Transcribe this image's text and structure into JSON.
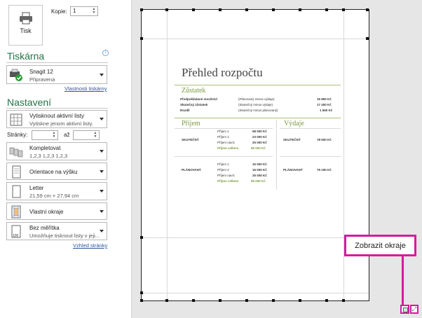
{
  "print_button": {
    "label": "Tisk"
  },
  "copies": {
    "label": "Kopie:",
    "value": "1"
  },
  "printer": {
    "section_title": "Tiskárna",
    "info_icon": "info-icon",
    "name": "Snagit 12",
    "status": "Připravena",
    "properties_link": "Vlastnosti tiskárny"
  },
  "settings": {
    "section_title": "Nastavení",
    "what": {
      "title": "Vytisknout aktivní listy",
      "subtitle": "Vytiskne jenom aktivní listy."
    },
    "pages": {
      "label": "Stránky:",
      "to_label": "až"
    },
    "collate": {
      "title": "Kompletovat",
      "subtitle": "1,2,3    1,2,3    1,2,3"
    },
    "orientation": {
      "title": "Orientace na výšku"
    },
    "paper": {
      "title": "Letter",
      "subtitle": "21,59 cm × 27,94 cm"
    },
    "margins": {
      "title": "Vlastní okraje"
    },
    "scaling": {
      "title": "Bez měřítka",
      "subtitle": "Umožňuje tisknout listy v jeji..."
    },
    "page_setup_link": "Vzhled stránky"
  },
  "preview": {
    "title": "Přehled rozpočtu",
    "balance": {
      "heading": "Zůstatek",
      "rows": [
        {
          "label": "Předpokládané množství",
          "desc": "(Plánovaný minus výdaje)",
          "value": "15 850 Kč"
        },
        {
          "label": "Skutečný zůstatek",
          "desc": "(Skutečný minus výdaje)",
          "value": "17 400 Kč"
        },
        {
          "label": "Rozdíl",
          "desc": "(Skutečný minus plánovaný)",
          "value": "1 550 Kč"
        }
      ]
    },
    "income": {
      "heading": "Příjem",
      "actual": {
        "label": "SKUTEČNÝ",
        "rows": [
          {
            "label": "Příjem 1",
            "value": "58 000 Kč"
          },
          {
            "label": "Příjem 2",
            "value": "23 000 Kč"
          },
          {
            "label": "Příjem navíc",
            "value": "25 000 Kč"
          }
        ],
        "total_label": "Příjem celkem",
        "total_value": "95 000 Kč"
      },
      "planned": {
        "label": "PLÁNOVANÝ",
        "rows": [
          {
            "label": "Příjem 1",
            "value": "15 000 Kč"
          },
          {
            "label": "Příjem 2",
            "value": "15 000 Kč"
          },
          {
            "label": "Příjem navíc",
            "value": "25 000 Kč"
          }
        ],
        "total_label": "Příjem celkem",
        "total_value": "95 000 Kč"
      }
    },
    "expenses": {
      "heading": "Výdaje",
      "actual": {
        "label": "SKUTEČNÝ",
        "value": "78 600 Kč"
      },
      "planned": {
        "label": "PLÁNOVANÝ",
        "value": "79 150 Kč"
      }
    }
  },
  "callout": {
    "label": "Zobrazit okraje"
  },
  "status_bar": {
    "show_margins_icon": "show-margins-icon",
    "zoom_icon": "zoom-to-page-icon"
  },
  "colors": {
    "accent": "#217346",
    "callout": "#d41c9e",
    "preview_heading": "#7a9a3e"
  }
}
